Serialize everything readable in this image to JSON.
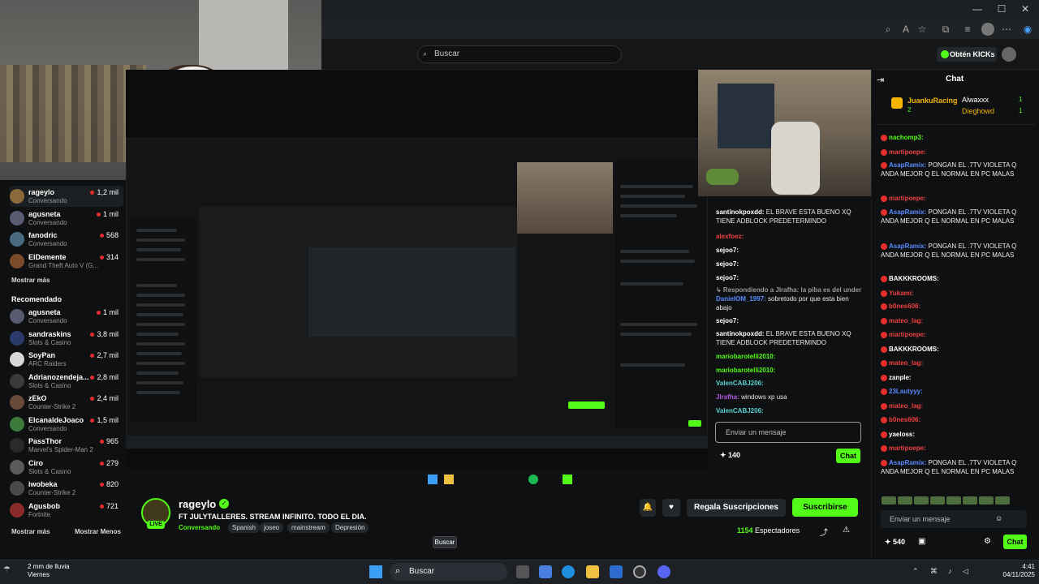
{
  "browser": {
    "win_min": "—",
    "win_max": "☐",
    "win_close": "✕",
    "toolbar_icons": [
      "zoom-icon",
      "read-aloud-icon",
      "favorite-icon",
      "extensions-icon",
      "favorites-bar-icon",
      "profile-icon",
      "more-icon",
      "copilot-icon"
    ]
  },
  "header": {
    "search_placeholder": "Buscar",
    "obten_kicks": "Obtén KICKs"
  },
  "sidebar": {
    "following": [
      {
        "name": "rageylo",
        "sub": "Conversando",
        "count": "1,2 mil",
        "color": "#8a6a3a"
      },
      {
        "name": "agusneta",
        "sub": "Conversando",
        "count": "1 mil",
        "color": "#5a5a70"
      },
      {
        "name": "fanodric",
        "sub": "Conversando",
        "count": "568",
        "color": "#4a6a80"
      },
      {
        "name": "ElDemente",
        "sub": "Grand Theft Auto V (G...",
        "count": "314",
        "color": "#7a4a2a"
      }
    ],
    "show_more": "Mostrar más",
    "recommended_title": "Recomendado",
    "recommended": [
      {
        "name": "agusneta",
        "sub": "Conversando",
        "count": "1 mil",
        "color": "#5a5a70"
      },
      {
        "name": "sandraskins",
        "sub": "Slots & Casino",
        "count": "3,8 mil",
        "color": "#2a3a6a"
      },
      {
        "name": "SoyPan",
        "sub": "ARC Raiders",
        "count": "2,7 mil",
        "color": "#d8d8d8"
      },
      {
        "name": "Adrianozendeja...",
        "sub": "Slots & Casino",
        "count": "2,8 mil",
        "color": "#3a3a3a"
      },
      {
        "name": "zEkO",
        "sub": "Counter-Strike 2",
        "count": "2,4 mil",
        "color": "#6a4a3a"
      },
      {
        "name": "ElcanaldeJoaco",
        "sub": "Conversando",
        "count": "1,5 mil",
        "color": "#3a7a3a"
      },
      {
        "name": "PassThor",
        "sub": "Marvel's Spider-Man 2",
        "count": "965",
        "color": "#2a2a2a"
      },
      {
        "name": "Ciro",
        "sub": "Slots & Casino",
        "count": "279",
        "color": "#5a5a5a"
      },
      {
        "name": "iwobeka",
        "sub": "Counter-Strike 2",
        "count": "820",
        "color": "#4a4a4a"
      },
      {
        "name": "Agusbob",
        "sub": "Fortnite",
        "count": "721",
        "color": "#8a2a2a"
      }
    ],
    "show_more_bottom": "Mostrar más",
    "show_less": "Mostrar Menos"
  },
  "mid_chat": {
    "lines": [
      {
        "user": "santinokpoxdd:",
        "text": "EL BRAVE ESTA BUENO XQ TIENE ADBLOCK PREDETERMINDO",
        "color": "#ffffff"
      },
      {
        "user": "alexfoez:",
        "text": "",
        "color": "#f04141"
      },
      {
        "user": "sejoo7:",
        "text": "",
        "color": "#ffffff"
      },
      {
        "user": "sejoo7:",
        "text": "",
        "color": "#ffffff"
      },
      {
        "user": "sejoo7:",
        "text": "",
        "color": "#ffffff"
      },
      {
        "user": "↳ Respondiendo a Jlrafha: la piba es del under",
        "text": "",
        "color": "#999999"
      },
      {
        "user": "DanielOM_1997:",
        "text": "sobretodo por que esta bien abajo",
        "color": "#5a8aff"
      },
      {
        "user": "sejoo7:",
        "text": "",
        "color": "#ffffff"
      },
      {
        "user": "santinokpoxdd:",
        "text": "EL BRAVE ESTA BUENO XQ TIENE ADBLOCK PREDETERMINDO",
        "color": "#ffffff"
      },
      {
        "user": "mariobarotelli2010:",
        "text": "",
        "color": "#53fc18"
      },
      {
        "user": "mariobarotelli2010:",
        "text": "",
        "color": "#53fc18"
      },
      {
        "user": "ValenCABJ206:",
        "text": "",
        "color": "#5ad1d1"
      },
      {
        "user": "Jlrafha:",
        "text": "windows xp usa",
        "color": "#b05ae0"
      },
      {
        "user": "ValenCABJ206:",
        "text": "",
        "color": "#5ad1d1"
      }
    ],
    "input_placeholder": "Enviar un mensaje",
    "count": "140",
    "chat_btn": "Chat"
  },
  "channel": {
    "live": "LIVE",
    "name": "rageylo",
    "title": "FT JULYTALLERES. STREAM INFINITO. TODO EL DIA.",
    "category": "Conversando",
    "tags": [
      "Spanish",
      "joseo",
      "mainstream",
      "Depresión"
    ],
    "gift_subs": "Regala Suscripciones",
    "subscribe": "Suscribirse",
    "viewers_num": "1154",
    "viewers_label": "Espectadores"
  },
  "chat": {
    "title": "Chat",
    "pinned": [
      {
        "user": "JuankuRacing",
        "count": "2"
      },
      {
        "user": "Alwaxxx",
        "count": "1"
      },
      {
        "user": "Dieghowd",
        "count": "1"
      }
    ],
    "lines": [
      {
        "user": "nachomp3:",
        "text": "",
        "color": "#53fc18"
      },
      {
        "user": "martipoepe:",
        "text": "",
        "color": "#f04141"
      },
      {
        "user": "AsapRamix:",
        "text": "PONGAN EL .7TV VIOLETA Q ANDA MEJOR Q EL NORMAL EN PC MALAS",
        "color": "#5a8aff"
      },
      {
        "user": "martipoepe:",
        "text": "",
        "color": "#f04141"
      },
      {
        "user": "AsapRamix:",
        "text": "PONGAN EL .7TV VIOLETA Q ANDA MEJOR Q EL NORMAL EN PC MALAS",
        "color": "#5a8aff"
      },
      {
        "user": "AsapRamix:",
        "text": "PONGAN EL .7TV VIOLETA Q ANDA MEJOR Q EL NORMAL EN PC MALAS",
        "color": "#5a8aff"
      },
      {
        "user": "BAKKKROOMS:",
        "text": "",
        "color": "#ffffff"
      },
      {
        "user": "Yukami:",
        "text": "",
        "color": "#f04141"
      },
      {
        "user": "b0nes606:",
        "text": "",
        "color": "#f04141"
      },
      {
        "user": "mateo_lag:",
        "text": "",
        "color": "#f04141"
      },
      {
        "user": "martipoepe:",
        "text": "",
        "color": "#f04141"
      },
      {
        "user": "BAKKKROOMS:",
        "text": "",
        "color": "#ffffff"
      },
      {
        "user": "mateo_lag:",
        "text": "",
        "color": "#f04141"
      },
      {
        "user": "zanple:",
        "text": "",
        "color": "#ffffff"
      },
      {
        "user": "23Lautyyy:",
        "text": "",
        "color": "#5a8aff"
      },
      {
        "user": "mateo_lag:",
        "text": "",
        "color": "#f04141"
      },
      {
        "user": "b0nes606:",
        "text": "",
        "color": "#f04141"
      },
      {
        "user": "yaeloss:",
        "text": "",
        "color": "#ffffff"
      },
      {
        "user": "martipoepe:",
        "text": "",
        "color": "#f04141"
      },
      {
        "user": "AsapRamix:",
        "text": "PONGAN EL .7TV VIOLETA Q ANDA MEJOR Q EL NORMAL EN PC MALAS",
        "color": "#5a8aff"
      }
    ],
    "input_placeholder": "Enviar un mensaje",
    "count": "540",
    "chat_btn": "Chat"
  },
  "taskbar": {
    "weather_temp": "2 mm de lluvia",
    "weather_day": "Viernes",
    "search": "Buscar",
    "tooltip": "Buscar",
    "time": "4:41",
    "date": "04/11/2025"
  }
}
